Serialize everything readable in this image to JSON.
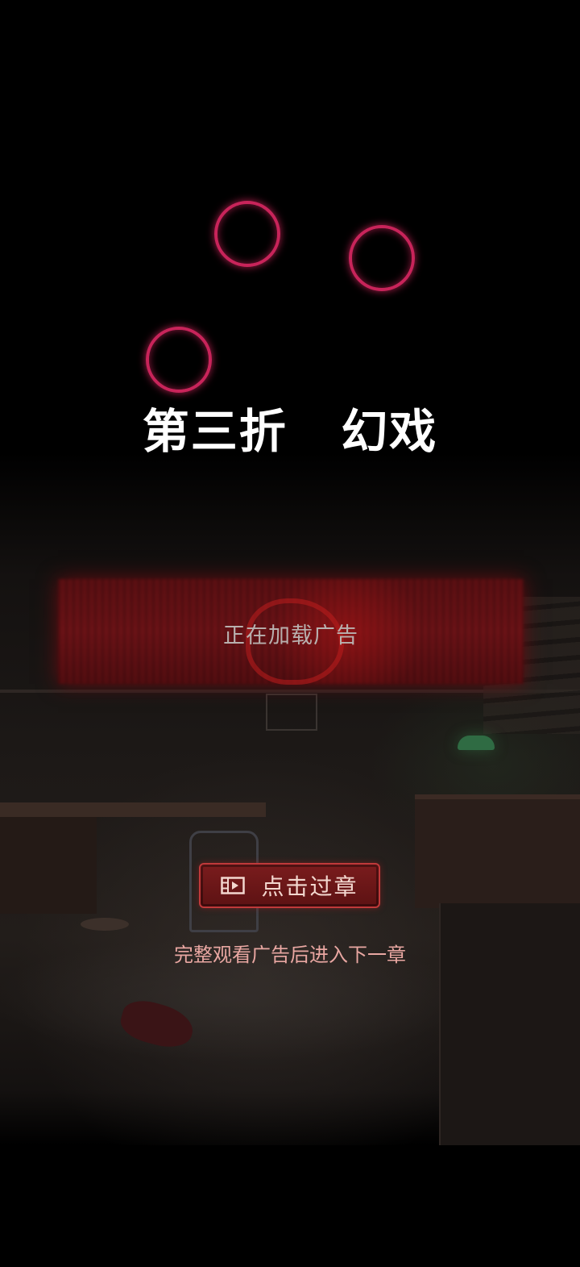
{
  "chapter": {
    "title": "第三折   幻戏"
  },
  "ad": {
    "loading_text": "正在加载广告"
  },
  "skip": {
    "button_label": "点击过章",
    "button_icon": "film-icon",
    "hint": "完整观看广告后进入下一章"
  },
  "colors": {
    "background": "#000000",
    "ring_glow": "#c8245a",
    "button_fill": "#6b1718",
    "button_border": "#c0393a",
    "hint_text": "#e9a7a2"
  }
}
